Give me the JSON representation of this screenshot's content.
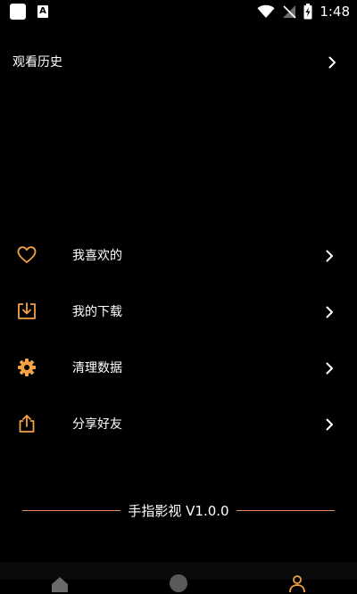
{
  "status_bar": {
    "time": "1:48",
    "a_label": "A",
    "icons": [
      "notification-square-icon",
      "text-a-icon",
      "wifi-icon",
      "no-signal-icon",
      "battery-charging-icon"
    ]
  },
  "history": {
    "label": "观看历史",
    "icon": "chevron-right-icon"
  },
  "menu": {
    "items": [
      {
        "label": "我喜欢的",
        "icon": "heart-icon"
      },
      {
        "label": "我的下载",
        "icon": "download-icon"
      },
      {
        "label": "清理数据",
        "icon": "gear-icon"
      },
      {
        "label": "分享好友",
        "icon": "share-icon"
      }
    ],
    "accent_color": "#f3a343"
  },
  "footer": {
    "version": "手指影视 V1.0.0",
    "line_color": "#e88b60"
  },
  "bottom_nav": {
    "icons": [
      "home-icon",
      "discover-icon",
      "profile-icon"
    ]
  }
}
